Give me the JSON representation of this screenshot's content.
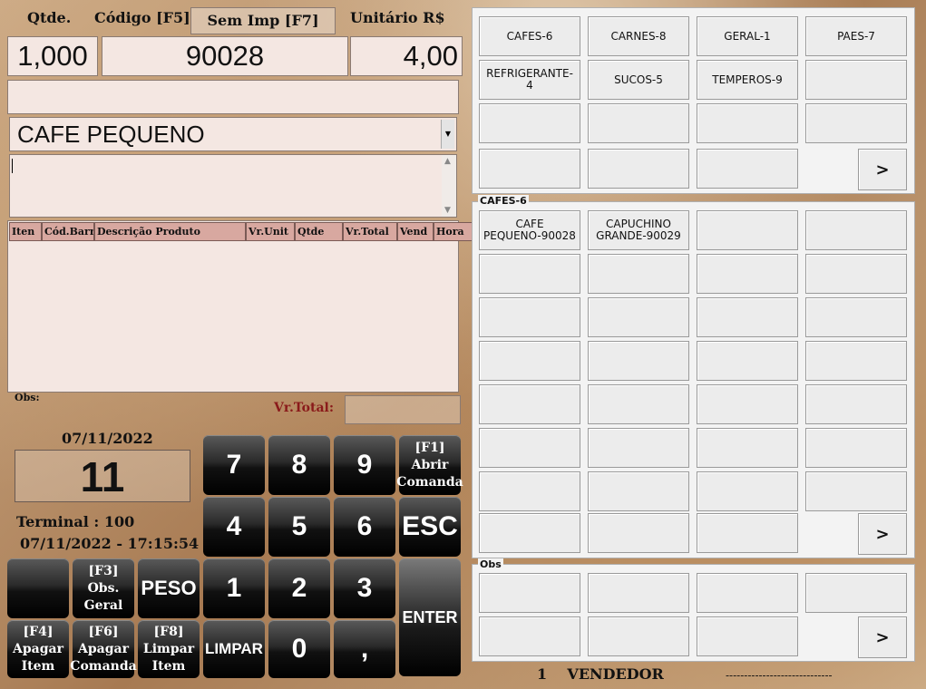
{
  "header": {
    "qtde_label": "Qtde.",
    "codigo_label": "Código [F5]",
    "semimp_label": "Sem Imp [F7]",
    "unitario_label": "Unitário R$"
  },
  "entry": {
    "qtde": "1,000",
    "codigo": "90028",
    "unitario": "4,00"
  },
  "product": {
    "selected": "CAFE PEQUENO"
  },
  "items_table": {
    "columns": [
      "Iten",
      "Cód.Barr",
      "Descrição Produto",
      "Vr.Unit",
      "Qtde",
      "Vr.Total",
      "Vend",
      "Hora"
    ]
  },
  "footer": {
    "obs_label": "Obs:",
    "vrtotal_label": "Vr.Total:",
    "date": "07/11/2022",
    "comanda": "11",
    "terminal": "Terminal : 100",
    "datetime": "07/11/2022 - 17:15:54"
  },
  "keypad": {
    "k7": "7",
    "k8": "8",
    "k9": "9",
    "k4": "4",
    "k5": "5",
    "k6": "6",
    "k1": "1",
    "k2": "2",
    "k3": "3",
    "k0": "0",
    "kcomma": ",",
    "f1": "[F1]\nAbrir\nComanda",
    "esc": "ESC",
    "f3": "[F3]\nObs.\nGeral",
    "peso": "PESO",
    "enter": "ENTER",
    "f4": "[F4]\nApagar\nItem",
    "f6": "[F6]\nApagar\nComanda",
    "f8": "[F8]\nLimpar\nItem",
    "limpar": "LIMPAR"
  },
  "groups": {
    "buttons": [
      "CAFES-6",
      "CARNES-8",
      "GERAL-1",
      "PAES-7",
      "REFRIGERANTE-\n4",
      "SUCOS-5",
      "TEMPEROS-9",
      "",
      "",
      "",
      "",
      "",
      "",
      "",
      "",
      ""
    ],
    "next": ">"
  },
  "products_panel": {
    "title": "CAFES-6",
    "buttons": [
      "CAFE\nPEQUENO-90028",
      "CAPUCHINO\nGRANDE-90029"
    ],
    "next": ">"
  },
  "obs_panel": {
    "title": "Obs",
    "next": ">"
  },
  "status": {
    "vendedor": "1    VENDEDOR",
    "line": "-----------------------------"
  }
}
